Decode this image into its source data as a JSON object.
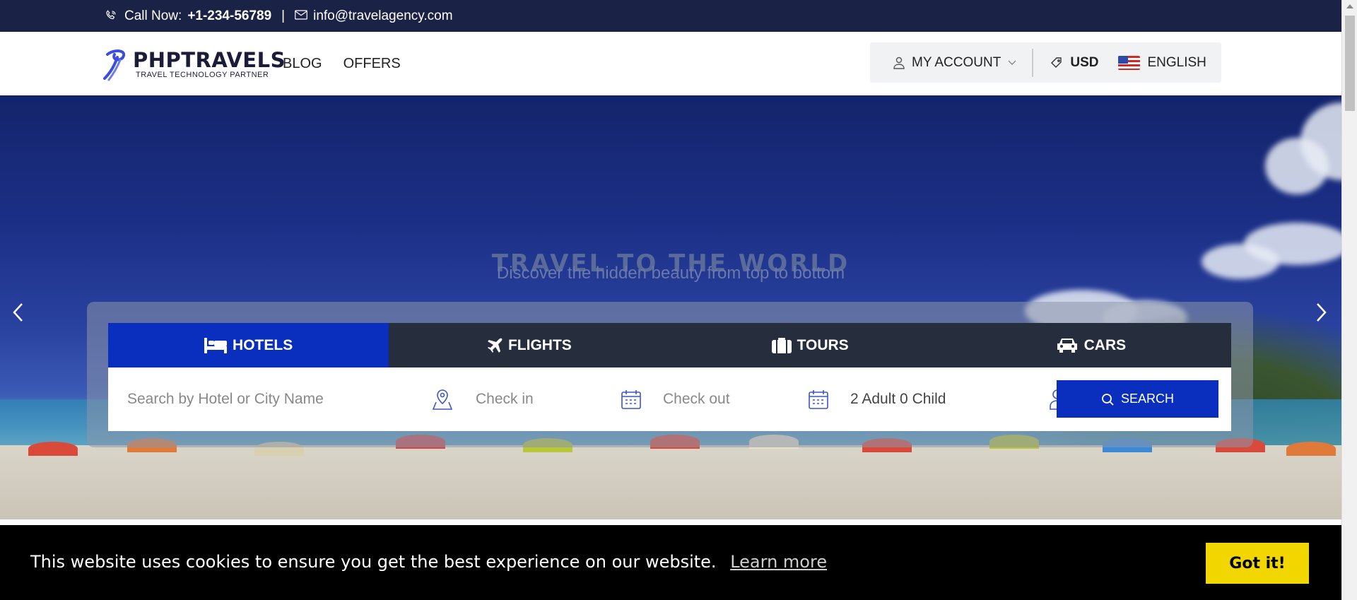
{
  "topbar": {
    "call_label": "Call Now:",
    "phone": "+1-234-56789",
    "separator": "|",
    "email": "info@travelagency.com"
  },
  "header": {
    "logo_name": "PHPTRAVELS",
    "logo_tagline": "TRAVEL TECHNOLOGY PARTNER",
    "nav": [
      "BLOG",
      "OFFERS"
    ],
    "account_label": "MY ACCOUNT",
    "currency": "USD",
    "language": "ENGLISH"
  },
  "hero": {
    "title": "TRAVEL TO THE WORLD",
    "subtitle": "Discover the hidden beauty from top to bottom"
  },
  "search": {
    "tabs": [
      {
        "label": "HOTELS",
        "icon": "bed-icon",
        "active": true
      },
      {
        "label": "FLIGHTS",
        "icon": "plane-icon",
        "active": false
      },
      {
        "label": "TOURS",
        "icon": "suitcase-icon",
        "active": false
      },
      {
        "label": "CARS",
        "icon": "car-icon",
        "active": false
      }
    ],
    "destination_placeholder": "Search by Hotel or City Name",
    "checkin_placeholder": "Check in",
    "checkout_placeholder": "Check out",
    "guests": "2 Adult 0 Child",
    "button_label": "SEARCH"
  },
  "cookie": {
    "message": "This website uses cookies to ensure you get the best experience on our website.",
    "learn_more": "Learn more",
    "accept": "Got it!"
  },
  "colors": {
    "topbar": "#1a2346",
    "primary": "#0a2fbf",
    "tabs_bg": "#262d3d",
    "cookie_btn": "#f1d600"
  }
}
